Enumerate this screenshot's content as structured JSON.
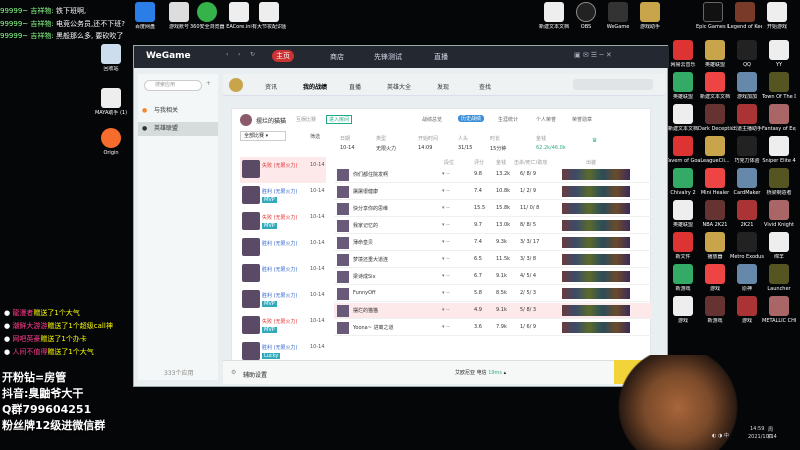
{
  "chat_top": [
    {
      "user": "99999~",
      "name": "吉祥物:",
      "msg": "铁下班啊,"
    },
    {
      "user": "99999~",
      "name": "吉祥物:",
      "msg": "电竞公务员,还不下班?"
    },
    {
      "user": "99999~",
      "name": "吉祥物:",
      "msg": "黑般那么多, 要砍吹了"
    }
  ],
  "gifts": [
    {
      "name": "龍漫者",
      "msg": "赠送了1个大气"
    },
    {
      "name": "潮鲜大游游",
      "msg": "赠送了1个超级call神"
    },
    {
      "name": "网吧英豪",
      "msg": "赠送了1个办卡"
    },
    {
      "name": "人间不值得",
      "msg": "赠送了1个大气"
    }
  ],
  "overlay_text": [
    "开粉钻=房管",
    "抖音:臭鼬爷大干",
    "Q群799604251",
    "粉丝牌12级进微信群"
  ],
  "desktop_icons_top": [
    "百度网盘",
    "游戏账号",
    "360安全浏览器",
    "EACore.ini",
    "有大节妆配识图服",
    "新建文本文档",
    "OBS",
    "WeGame",
    "游戏助手",
    "Epic Games Launcher",
    "Legend of Keepers...",
    "开始游戏"
  ],
  "desktop_icons_left": [
    "回收站",
    "MAYA助手 (1)",
    "Origin"
  ],
  "desktop_icons_right": [
    "网易云音乐",
    "英雄联盟",
    "QQ",
    "YY",
    "英雄联盟",
    "新建文本文档",
    "游戏加加",
    "Town Of The Dead...",
    "新建文本文档",
    "Dark Deception",
    "出道主播助手",
    "Fantasy of Expedit...",
    "Tavern of Goats",
    "LeagueCli...",
    "巧克力体验",
    "Sniper Elite 4",
    "Chivalry 2",
    "Mini Healer",
    "CardMaker",
    "桥梁制造者",
    "英雄联盟",
    "NBA 2K21",
    "2K21",
    "Vivid Knight",
    "新文件",
    "播放器",
    "Metro Exodus",
    "绵羊",
    "新游戏",
    "游戏",
    "原神",
    "Launcher",
    "游戏",
    "新游戏",
    "游戏",
    "METALLIC CHILD"
  ],
  "wegame": {
    "logo": "WeGame",
    "nav": [
      "主页",
      "商店",
      "先锋测试",
      "直播"
    ],
    "sidebar_search": "搜索应用",
    "sidebar_items": [
      "与我相关",
      "英雄联盟"
    ],
    "sidebar_footer": "333个应用",
    "game_tabs": [
      "资讯",
      "我的战绩",
      "直播",
      "英雄大全",
      "发现",
      "查找"
    ],
    "profile_name": "摆烂的猫猫",
    "profile_tabs": [
      "互娱比赛",
      "进入房间"
    ],
    "subtabs": [
      "战绩总览",
      "历史战绩",
      "生涯统计",
      "个人荣誉",
      "荣誉勋章"
    ],
    "filter": "全部比赛",
    "filter_right": "筛选",
    "summary_headers": [
      "日期",
      "类型",
      "开始时间",
      "人头",
      "时长",
      "金钱"
    ],
    "summary_values": [
      "10-14",
      "无限火力",
      "14:09",
      "31/15",
      "15分钟",
      "62.2k/46.0k"
    ],
    "match_list": [
      {
        "mode": "失败 (无限火力)",
        "date": "10-14",
        "badge": ""
      },
      {
        "mode": "胜利 (无限火力)",
        "date": "10-14",
        "badge": "MVP"
      },
      {
        "mode": "失败 (无限火力)",
        "date": "10-14",
        "badge": "MVP"
      },
      {
        "mode": "胜利 (无限火力)",
        "date": "10-14",
        "badge": ""
      },
      {
        "mode": "胜利 (无限火力)",
        "date": "10-14",
        "badge": ""
      },
      {
        "mode": "胜利 (无限火力)",
        "date": "10-14",
        "badge": "MVP"
      },
      {
        "mode": "失败 (无限火力)",
        "date": "10-14",
        "badge": "MVP"
      },
      {
        "mode": "胜利 (无限火力)",
        "date": "10-14",
        "badge": "Lucky"
      }
    ],
    "table_headers": [
      "段位",
      "评分",
      "金钱",
      "击杀/死亡/助攻",
      "出装"
    ],
    "players": [
      {
        "name": "你们都住院发啊",
        "rating": "9.8",
        "gold": "13.2k",
        "kda": "6/ 8/ 9"
      },
      {
        "name": "屠屠很健康",
        "rating": "7.4",
        "gold": "10.8k",
        "kda": "1/ 2/ 9"
      },
      {
        "name": "快分享你的思维",
        "rating": "15.5",
        "gold": "15.8k",
        "kda": "11/ 0/ 8"
      },
      {
        "name": "我家记忆的",
        "rating": "9.7",
        "gold": "13.0k",
        "kda": "8/ 8/ 5"
      },
      {
        "name": "薄命皇贝",
        "rating": "7.4",
        "gold": "9.3k",
        "kda": "3/ 3/ 17"
      },
      {
        "name": "梦境还重大道连",
        "rating": "6.5",
        "gold": "11.5k",
        "kda": "3/ 3/ 8"
      },
      {
        "name": "梁诗成Six",
        "rating": "6.7",
        "gold": "9.1k",
        "kda": "4/ 5/ 4"
      },
      {
        "name": "FunnyOff",
        "rating": "5.8",
        "gold": "8.5k",
        "kda": "2/ 5/ 3"
      },
      {
        "name": "摆烂的猫猫",
        "rating": "4.9",
        "gold": "9.1k",
        "kda": "5/ 8/ 3"
      },
      {
        "name": "Yoona~ 进离之道",
        "rating": "3.6",
        "gold": "7.9k",
        "kda": "1/ 6/ 9"
      }
    ],
    "bottom_settings": "辅助设置",
    "bottom_status": "艾欧尼亚 电信",
    "bottom_ping": "19ms",
    "start_label": "启动"
  },
  "taskbar": {
    "time": "14:59",
    "date": "2021/10/14",
    "day": "周四",
    "lang": "中"
  }
}
